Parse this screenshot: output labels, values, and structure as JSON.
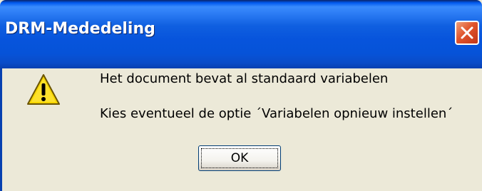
{
  "window": {
    "title": "DRM-Mededeling",
    "close_icon": "close-icon"
  },
  "message": {
    "icon": "warning-icon",
    "line1": "Het document bevat al standaard variabelen",
    "line2": "Kies eventueel de optie ´Variabelen opnieuw instellen´"
  },
  "buttons": {
    "ok_label": "OK"
  },
  "colors": {
    "titlebar": "#0054e3",
    "close_button": "#e0542c",
    "dialog_background": "#ece9d8",
    "warning_yellow": "#f7d600"
  }
}
